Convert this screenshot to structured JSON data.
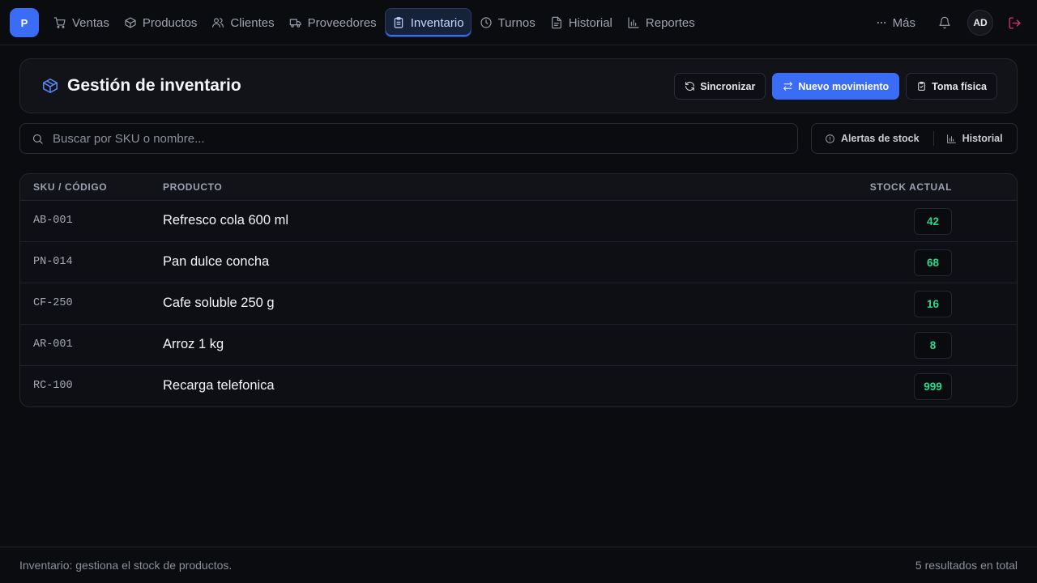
{
  "brand": {
    "logo_letter": "P",
    "accent": "#3b6cf6"
  },
  "nav": {
    "items": [
      {
        "label": "Ventas",
        "icon": "cart-icon"
      },
      {
        "label": "Productos",
        "icon": "box-icon"
      },
      {
        "label": "Clientes",
        "icon": "users-icon"
      },
      {
        "label": "Proveedores",
        "icon": "truck-icon"
      },
      {
        "label": "Inventario",
        "icon": "clipboard-icon",
        "active": true
      },
      {
        "label": "Turnos",
        "icon": "clock-icon"
      },
      {
        "label": "Historial",
        "icon": "file-icon"
      },
      {
        "label": "Reportes",
        "icon": "bar-chart-icon"
      }
    ],
    "more_label": "Más",
    "avatar_initials": "AD"
  },
  "header": {
    "title": "Gestión de inventario",
    "actions": {
      "sync": "Sincronizar",
      "new_movement": "Nuevo movimiento",
      "physical_count": "Toma física"
    }
  },
  "search": {
    "placeholder": "Buscar por SKU o nombre...",
    "value": ""
  },
  "filters": {
    "alerts": "Alertas de stock",
    "history": "Historial"
  },
  "table": {
    "columns": {
      "sku": "SKU / CÓDIGO",
      "product": "PRODUCTO",
      "stock": "STOCK ACTUAL"
    },
    "rows": [
      {
        "sku": "AB-001",
        "product": "Refresco cola 600 ml",
        "stock": "42"
      },
      {
        "sku": "PN-014",
        "product": "Pan dulce concha",
        "stock": "68"
      },
      {
        "sku": "CF-250",
        "product": "Cafe soluble 250 g",
        "stock": "16"
      },
      {
        "sku": "AR-001",
        "product": "Arroz 1 kg",
        "stock": "8"
      },
      {
        "sku": "RC-100",
        "product": "Recarga telefonica",
        "stock": "999"
      }
    ],
    "stock_color": "#2bd98b"
  },
  "footer": {
    "description": "Inventario: gestiona el stock de productos.",
    "count": "5 resultados en total"
  }
}
